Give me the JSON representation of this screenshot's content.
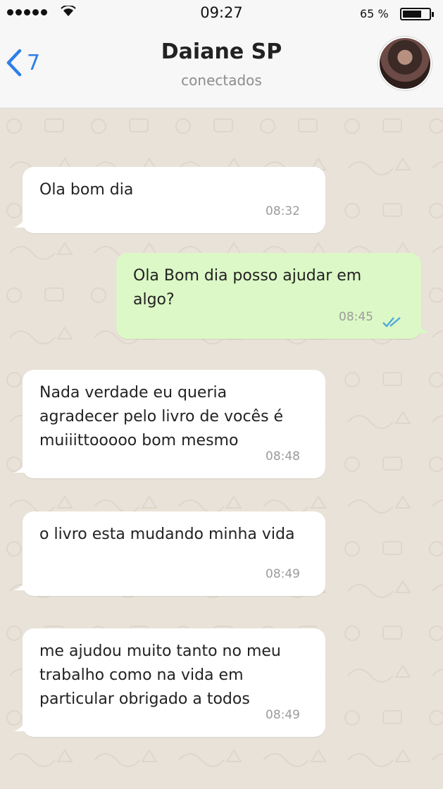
{
  "status_bar": {
    "time": "09:27",
    "battery": "65 %"
  },
  "header": {
    "back_count": "7",
    "contact_name": "Daiane SP",
    "contact_status": "conectados"
  },
  "messages": [
    {
      "direction": "in",
      "text": "Ola bom dia",
      "time": "08:32"
    },
    {
      "direction": "out",
      "text": "Ola Bom dia posso ajudar em algo?",
      "time": "08:45",
      "read": true
    },
    {
      "direction": "in",
      "text": "Nada verdade eu queria agradecer pelo livro de vocês é muiiittooooo bom mesmo",
      "time": "08:48"
    },
    {
      "direction": "in",
      "text": "o livro esta mudando minha vida",
      "time": "08:49"
    },
    {
      "direction": "in",
      "text": "me ajudou muito tanto no meu trabalho como na vida em particular obrigado a todos",
      "time": "08:49"
    }
  ],
  "colors": {
    "incoming_bubble": "#ffffff",
    "outgoing_bubble": "#dcf8c6",
    "accent": "#2e7ee8",
    "read_ticks": "#4fa9dd"
  }
}
